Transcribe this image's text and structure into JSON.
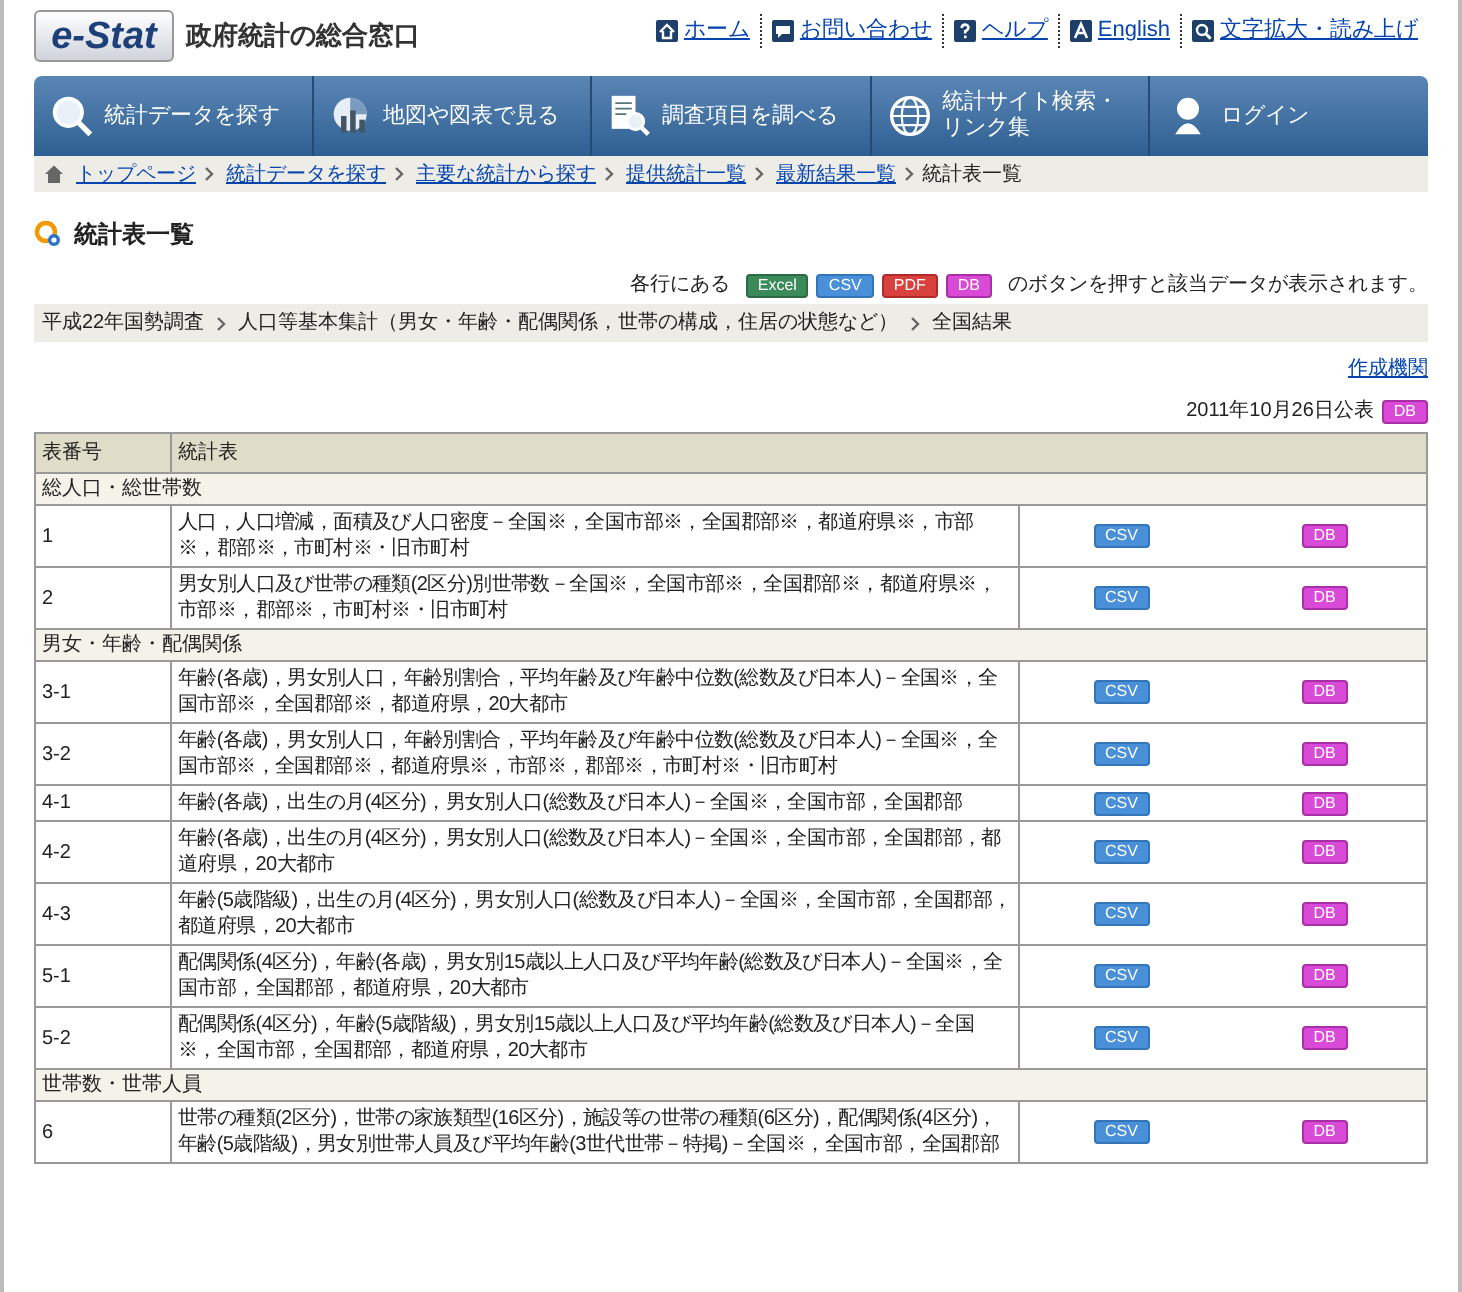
{
  "header": {
    "logo": "e-Stat",
    "site_title": "政府統計の総合窓口",
    "utility_links": [
      {
        "label": "ホーム"
      },
      {
        "label": "お問い合わせ"
      },
      {
        "label": "ヘルプ"
      },
      {
        "label": "English"
      },
      {
        "label": "文字拡大・読み上げ"
      }
    ]
  },
  "nav": [
    {
      "label": "統計データを探す"
    },
    {
      "label": "地図や図表で見る"
    },
    {
      "label": "調査項目を調べる"
    },
    {
      "label": "統計サイト検索・リンク集"
    },
    {
      "label": "ログイン"
    }
  ],
  "breadcrumb": {
    "links": [
      "トップページ",
      "統計データを探す",
      "主要な統計から探す",
      "提供統計一覧",
      "最新結果一覧"
    ],
    "current": "統計表一覧"
  },
  "page_title": "統計表一覧",
  "legend": {
    "prefix": "各行にある",
    "buttons": [
      {
        "label": "Excel",
        "kind": "excel"
      },
      {
        "label": "CSV",
        "kind": "csv"
      },
      {
        "label": "PDF",
        "kind": "pdf"
      },
      {
        "label": "DB",
        "kind": "db"
      }
    ],
    "suffix": "のボタンを押すと該当データが表示されます。"
  },
  "path": [
    "平成22年国勢調査",
    "人口等基本集計（男女・年齢・配偶関係，世帯の構成，住居の状態など）",
    "全国結果"
  ],
  "agency_link": "作成機関",
  "release": {
    "date": "2011年10月26日公表",
    "button": {
      "label": "DB",
      "kind": "db"
    }
  },
  "table": {
    "columns": [
      "表番号",
      "統計表"
    ],
    "sections": [
      {
        "title": "総人口・総世帯数",
        "rows": [
          {
            "number": "1",
            "title": "人口，人口増減，面積及び人口密度－全国※，全国市部※，全国郡部※，都道府県※，市部※，郡部※，市町村※・旧市町村",
            "buttons": [
              {
                "label": "CSV",
                "kind": "csv"
              },
              {
                "label": "DB",
                "kind": "db"
              }
            ]
          },
          {
            "number": "2",
            "title": "男女別人口及び世帯の種類(2区分)別世帯数－全国※，全国市部※，全国郡部※，都道府県※，市部※，郡部※，市町村※・旧市町村",
            "buttons": [
              {
                "label": "CSV",
                "kind": "csv"
              },
              {
                "label": "DB",
                "kind": "db"
              }
            ]
          }
        ]
      },
      {
        "title": "男女・年齢・配偶関係",
        "rows": [
          {
            "number": "3-1",
            "title": "年齢(各歳)，男女別人口，年齢別割合，平均年齢及び年齢中位数(総数及び日本人)－全国※，全国市部※，全国郡部※，都道府県，20大都市",
            "buttons": [
              {
                "label": "CSV",
                "kind": "csv"
              },
              {
                "label": "DB",
                "kind": "db"
              }
            ]
          },
          {
            "number": "3-2",
            "title": "年齢(各歳)，男女別人口，年齢別割合，平均年齢及び年齢中位数(総数及び日本人)－全国※，全国市部※，全国郡部※，都道府県※，市部※，郡部※，市町村※・旧市町村",
            "buttons": [
              {
                "label": "CSV",
                "kind": "csv"
              },
              {
                "label": "DB",
                "kind": "db"
              }
            ]
          },
          {
            "number": "4-1",
            "title": "年齢(各歳)，出生の月(4区分)，男女別人口(総数及び日本人)－全国※，全国市部，全国郡部",
            "buttons": [
              {
                "label": "CSV",
                "kind": "csv"
              },
              {
                "label": "DB",
                "kind": "db"
              }
            ]
          },
          {
            "number": "4-2",
            "title": "年齢(各歳)，出生の月(4区分)，男女別人口(総数及び日本人)－全国※，全国市部，全国郡部，都道府県，20大都市",
            "buttons": [
              {
                "label": "CSV",
                "kind": "csv"
              },
              {
                "label": "DB",
                "kind": "db"
              }
            ]
          },
          {
            "number": "4-3",
            "title": "年齢(5歳階級)，出生の月(4区分)，男女別人口(総数及び日本人)－全国※，全国市部，全国郡部，都道府県，20大都市",
            "buttons": [
              {
                "label": "CSV",
                "kind": "csv"
              },
              {
                "label": "DB",
                "kind": "db"
              }
            ]
          },
          {
            "number": "5-1",
            "title": "配偶関係(4区分)，年齢(各歳)，男女別15歳以上人口及び平均年齢(総数及び日本人)－全国※，全国市部，全国郡部，都道府県，20大都市",
            "buttons": [
              {
                "label": "CSV",
                "kind": "csv"
              },
              {
                "label": "DB",
                "kind": "db"
              }
            ]
          },
          {
            "number": "5-2",
            "title": "配偶関係(4区分)，年齢(5歳階級)，男女別15歳以上人口及び平均年齢(総数及び日本人)－全国※，全国市部，全国郡部，都道府県，20大都市",
            "buttons": [
              {
                "label": "CSV",
                "kind": "csv"
              },
              {
                "label": "DB",
                "kind": "db"
              }
            ]
          }
        ]
      },
      {
        "title": "世帯数・世帯人員",
        "rows": [
          {
            "number": "6",
            "title": "世帯の種類(2区分)，世帯の家族類型(16区分)，施設等の世帯の種類(6区分)，配偶関係(4区分)，年齢(5歳階級)，男女別世帯人員及び平均年齢(3世代世帯－特掲)－全国※，全国市部，全国郡部",
            "buttons": [
              {
                "label": "CSV",
                "kind": "csv"
              },
              {
                "label": "DB",
                "kind": "db"
              }
            ]
          }
        ]
      }
    ]
  }
}
